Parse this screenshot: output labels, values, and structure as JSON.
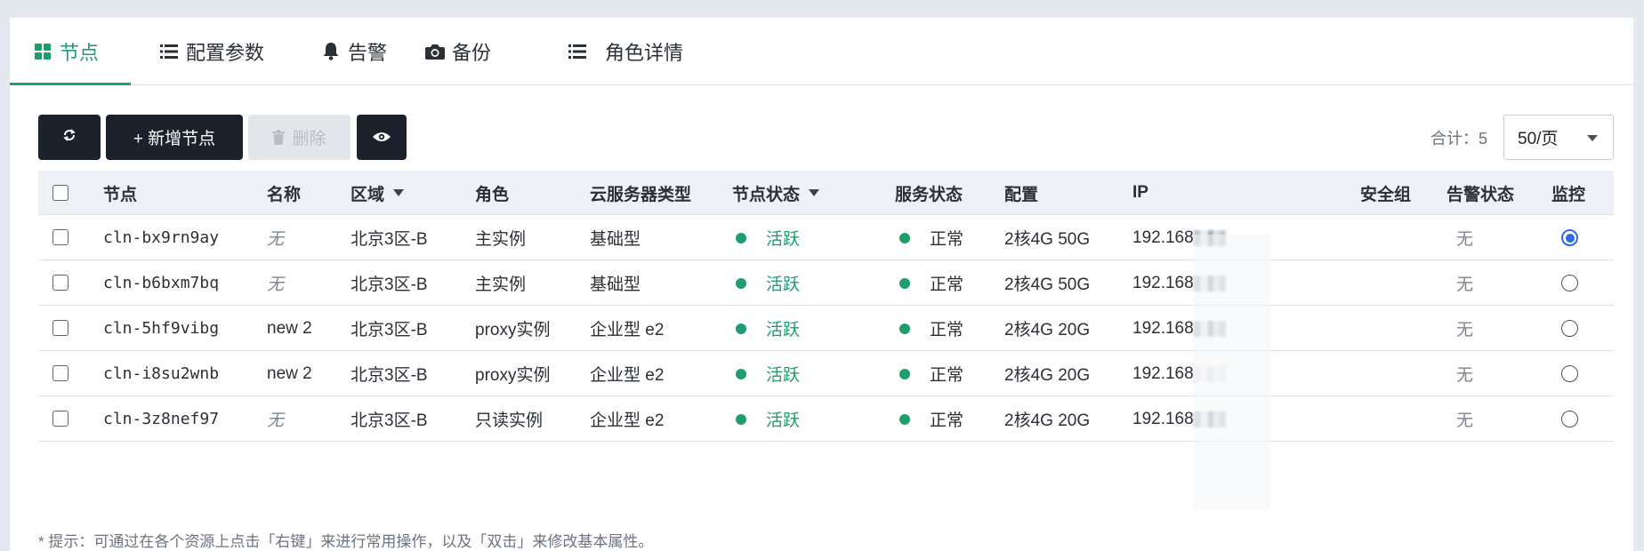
{
  "tabs": [
    {
      "label": "节点",
      "icon": "grid-icon",
      "active": true
    },
    {
      "label": "配置参数",
      "icon": "list-icon",
      "active": false
    },
    {
      "label": "告警",
      "icon": "bell-icon",
      "active": false
    },
    {
      "label": "备份",
      "icon": "camera-icon",
      "active": false
    },
    {
      "label": "角色详情",
      "icon": "list-icon",
      "active": false
    }
  ],
  "toolbar": {
    "refresh_icon": "refresh-icon",
    "add_label": "+ 新增节点",
    "delete_label": "删除",
    "view_icon": "eye-icon",
    "total_label": "合计：5",
    "page_size": "50/页"
  },
  "table": {
    "columns": [
      "节点",
      "名称",
      "区域",
      "角色",
      "云服务器类型",
      "节点状态",
      "服务状态",
      "配置",
      "IP",
      "安全组",
      "告警状态",
      "监控"
    ],
    "rows": [
      {
        "node": "cln-bx9rn9ay",
        "name": "无",
        "region": "北京3区-B",
        "role": "主实例",
        "server_type": "基础型",
        "node_status": "活跃",
        "service_status": "正常",
        "config": "2核4G 50G",
        "ip": "192.168",
        "security_group": "",
        "alarm": "无",
        "monitor": true
      },
      {
        "node": "cln-b6bxm7bq",
        "name": "无",
        "region": "北京3区-B",
        "role": "主实例",
        "server_type": "基础型",
        "node_status": "活跃",
        "service_status": "正常",
        "config": "2核4G 50G",
        "ip": "192.168",
        "security_group": "",
        "alarm": "无",
        "monitor": false
      },
      {
        "node": "cln-5hf9vibg",
        "name": "new 2",
        "region": "北京3区-B",
        "role": "proxy实例",
        "server_type": "企业型 e2",
        "node_status": "活跃",
        "service_status": "正常",
        "config": "2核4G 20G",
        "ip": "192.168",
        "security_group": "",
        "alarm": "无",
        "monitor": false
      },
      {
        "node": "cln-i8su2wnb",
        "name": "new 2",
        "region": "北京3区-B",
        "role": "proxy实例",
        "server_type": "企业型 e2",
        "node_status": "活跃",
        "service_status": "正常",
        "config": "2核4G 20G",
        "ip": "192.168",
        "security_group": "",
        "alarm": "无",
        "monitor": false
      },
      {
        "node": "cln-3z8nef97",
        "name": "无",
        "region": "北京3区-B",
        "role": "只读实例",
        "server_type": "企业型 e2",
        "node_status": "活跃",
        "service_status": "正常",
        "config": "2核4G 20G",
        "ip": "192.168",
        "security_group": "",
        "alarm": "无",
        "monitor": false
      }
    ]
  },
  "hint": "* 提示：可通过在各个资源上点击「右键」来进行常用操作，以及「双击」来修改基本属性。",
  "colors": {
    "accent_green": "#1f9d6b",
    "dark_button": "#1b222b",
    "radio_blue": "#2a6ae8"
  }
}
